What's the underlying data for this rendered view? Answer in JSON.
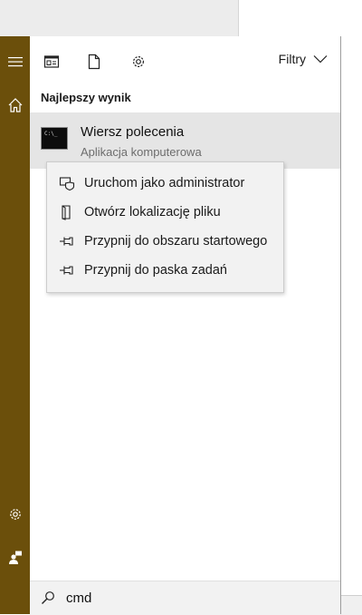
{
  "toolbar": {
    "filters_label": "Filtry"
  },
  "results": {
    "section_title": "Najlepszy wynik",
    "best": {
      "title": "Wiersz polecenia",
      "subtitle": "Aplikacja komputerowa",
      "icon_text": "C:\\_"
    }
  },
  "context_menu": {
    "items": [
      {
        "label": "Uruchom jako administrator",
        "icon": "shield-icon"
      },
      {
        "label": "Otwórz lokalizację pliku",
        "icon": "file-location-icon"
      },
      {
        "label": "Przypnij do obszaru startowego",
        "icon": "pin-icon"
      },
      {
        "label": "Przypnij do paska zadań",
        "icon": "pin-icon"
      }
    ]
  },
  "search": {
    "query": "cmd"
  },
  "colors": {
    "sidebar": "#6b4f0b",
    "result_highlight": "#e5e5e5",
    "context_menu_bg": "#f2f2f2"
  }
}
